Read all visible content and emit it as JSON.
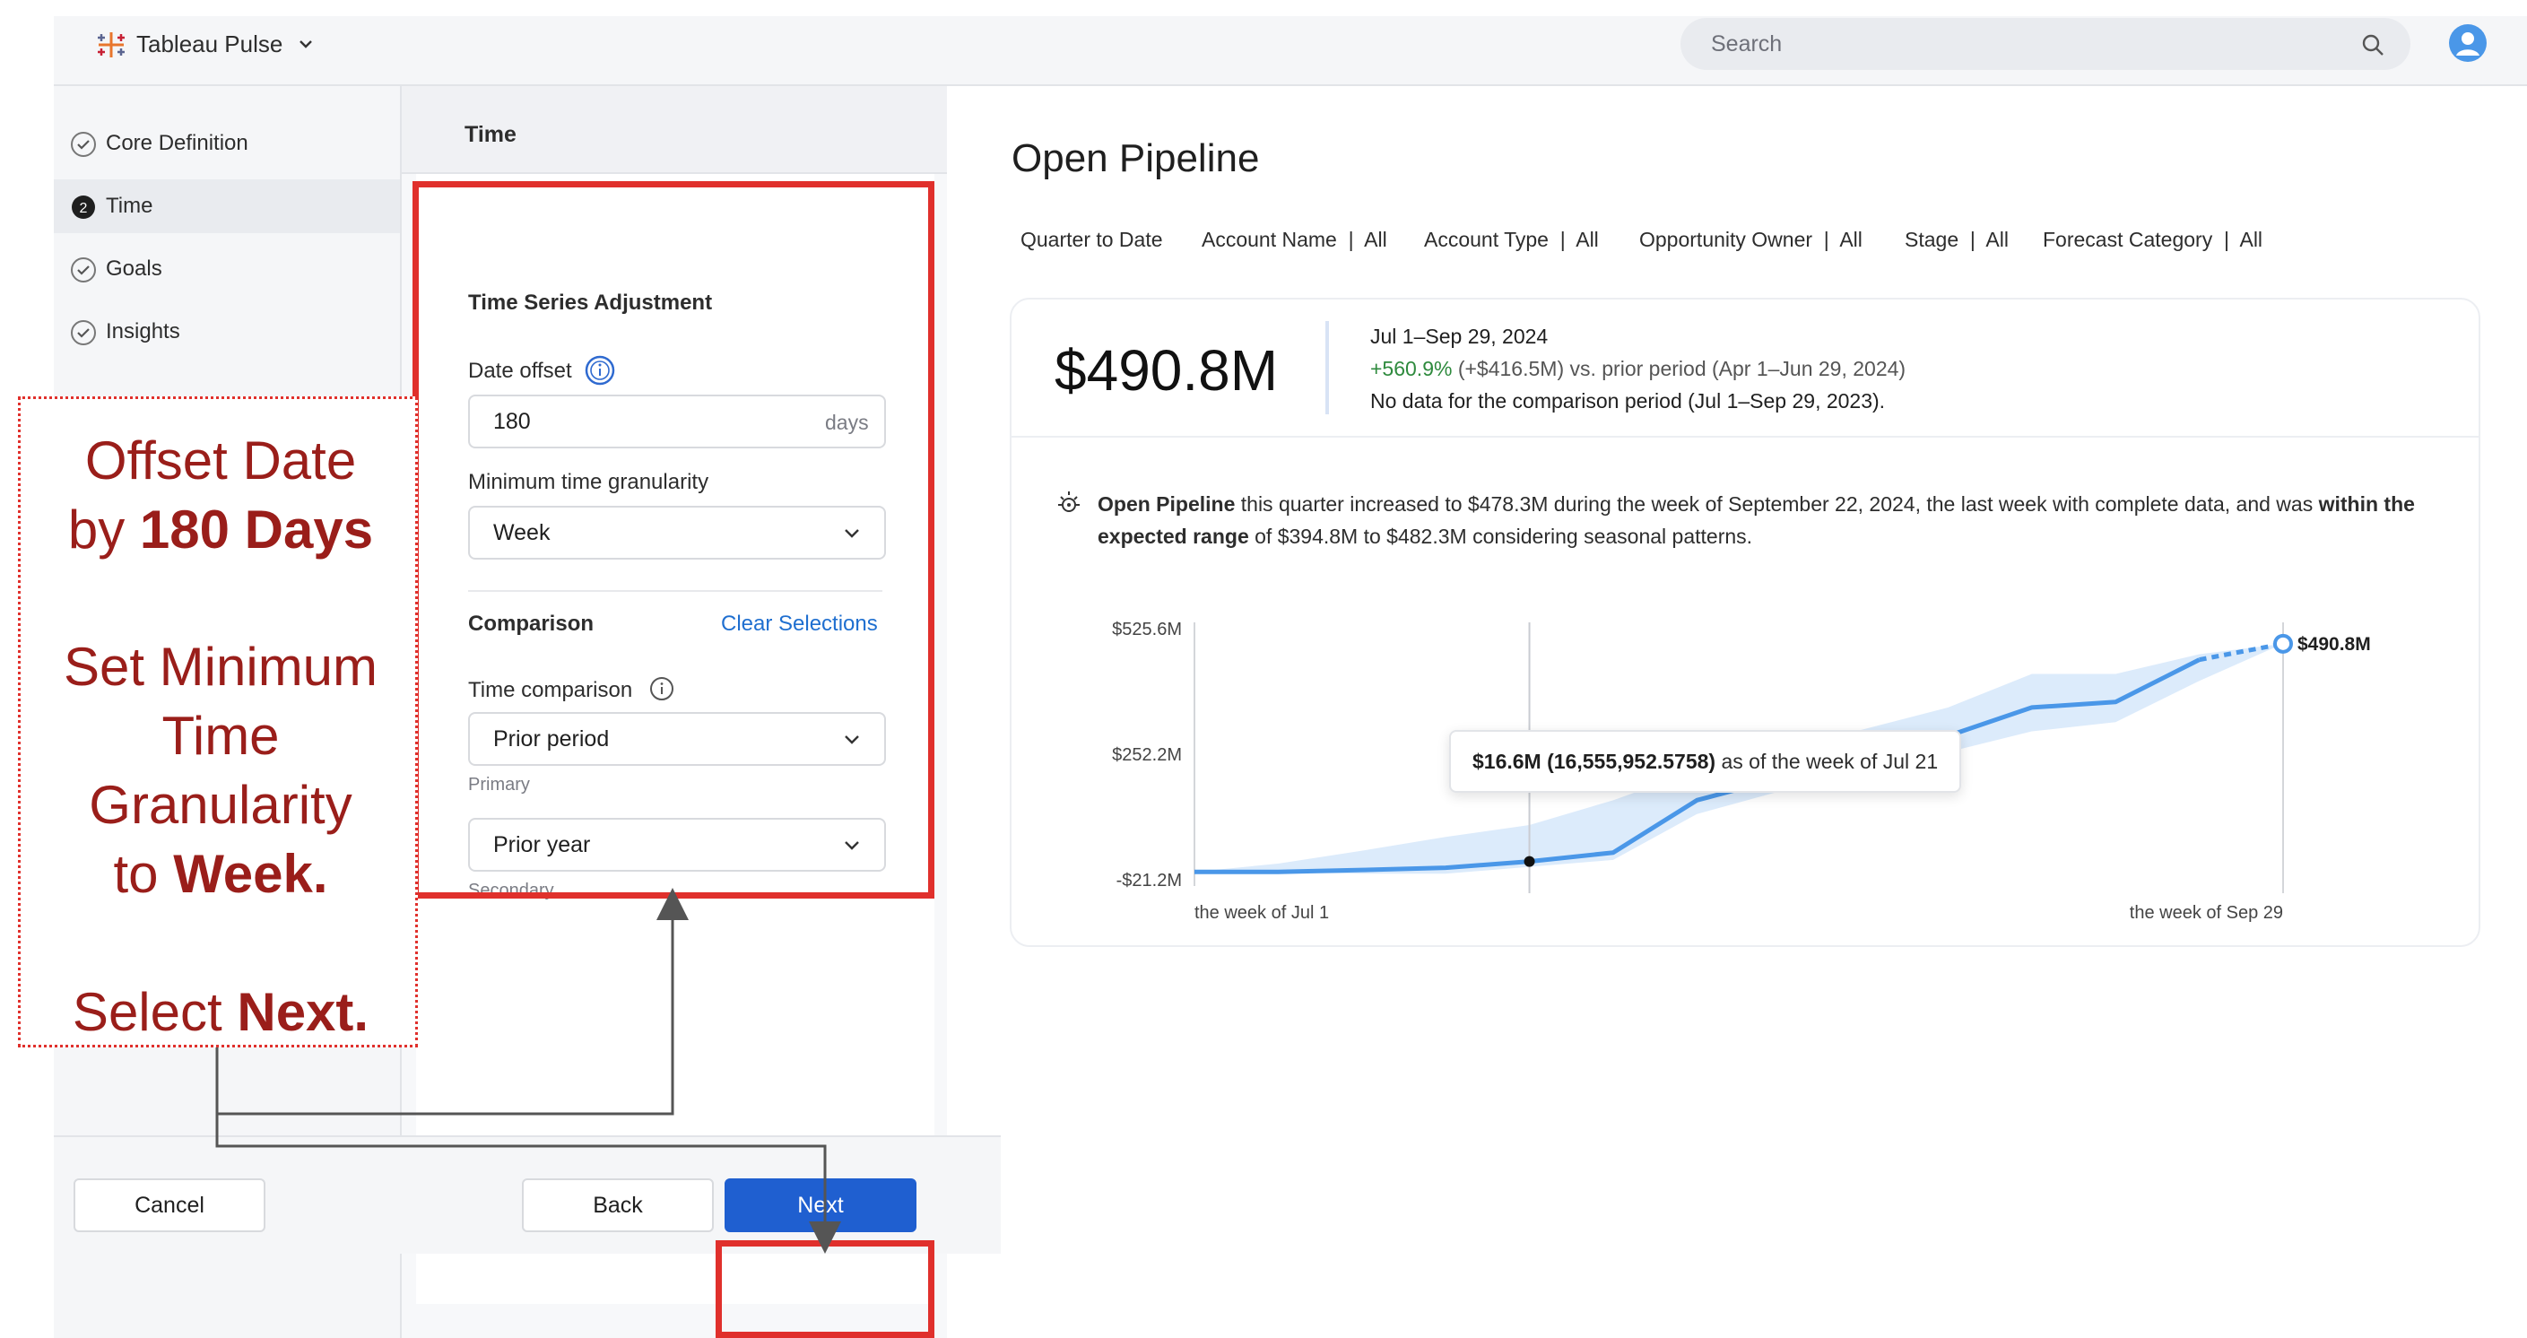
{
  "app": {
    "brand": "Tableau Pulse"
  },
  "search": {
    "placeholder": "Search"
  },
  "steps": [
    {
      "label": "Core Definition",
      "state": "done"
    },
    {
      "label": "Time",
      "state": "current",
      "number": "2"
    },
    {
      "label": "Goals",
      "state": "done"
    },
    {
      "label": "Insights",
      "state": "done"
    }
  ],
  "panel": {
    "title": "Time",
    "section_title": "Time Series Adjustment",
    "date_offset_label": "Date offset",
    "date_offset_value": "180",
    "date_offset_unit": "days",
    "granularity_label": "Minimum time granularity",
    "granularity_value": "Week",
    "comparison_title": "Comparison",
    "clear_selections": "Clear Selections",
    "time_comparison_label": "Time comparison",
    "primary_value": "Prior period",
    "primary_label": "Primary",
    "secondary_value": "Prior year",
    "secondary_label": "Secondary"
  },
  "footer": {
    "cancel": "Cancel",
    "back": "Back",
    "next": "Next"
  },
  "annotation": {
    "line1a": "Offset Date",
    "line2a": "by ",
    "line2b": "180 Days",
    "line3": "Set Minimum",
    "line4": "Time",
    "line5": "Granularity",
    "line6a": "to ",
    "line6b": "Week.",
    "line7a": "Select ",
    "line7b": "Next.",
    "color": "#e0302c"
  },
  "metric": {
    "title": "Open Pipeline",
    "filters": [
      {
        "name": "Quarter to Date",
        "value": ""
      },
      {
        "name": "Account Name",
        "value": "All"
      },
      {
        "name": "Account Type",
        "value": "All"
      },
      {
        "name": "Opportunity Owner",
        "value": "All"
      },
      {
        "name": "Stage",
        "value": "All"
      },
      {
        "name": "Forecast Category",
        "value": "All"
      }
    ],
    "value": "$490.8M",
    "period": "Jul 1–Sep 29, 2024",
    "delta_pct": "+560.9%",
    "delta_rest": " (+$416.5M) vs. prior period (Apr 1–Jun 29, 2024)",
    "no_data": "No data for the comparison period (Jul 1–Sep 29, 2023).",
    "insight_bold1": "Open Pipeline",
    "insight_text1": " this quarter increased to $478.3M during the week of September 22, 2024, the last week with complete data, and was",
    "insight_bold2": "within the expected range",
    "insight_text2": " of $394.8M to $482.3M considering seasonal patterns.",
    "tooltip_bold": "$16.6M (16,555,952.5758)",
    "tooltip_rest": " as of the week of Jul 21",
    "accent": "#4a97e8"
  },
  "chart_data": {
    "type": "line",
    "ytick_labels": [
      "$525.6M",
      "$252.2M",
      "-$21.2M"
    ],
    "ylim": [
      -21.2,
      525.6
    ],
    "xtick_labels": [
      "the week of Jul 1",
      "the week of Sep 29"
    ],
    "end_label": "$490.8M",
    "series": [
      {
        "values": [
          -6,
          -6,
          -2,
          3,
          16.6,
          36,
          150,
          198,
          252,
          290,
          352,
          364,
          456,
          490.8
        ]
      }
    ],
    "band_upper": [
      -6,
      12,
      40,
      70,
      96,
      150,
      215,
      262,
      305,
      352,
      425,
      425,
      468,
      490.8
    ],
    "band_lower": [
      -6,
      -8,
      -10,
      -10,
      5,
      20,
      120,
      170,
      210,
      255,
      300,
      320,
      410,
      490.8
    ],
    "projected_from_index": 12,
    "highlight_index": 4,
    "grid": false,
    "legend": "none"
  }
}
